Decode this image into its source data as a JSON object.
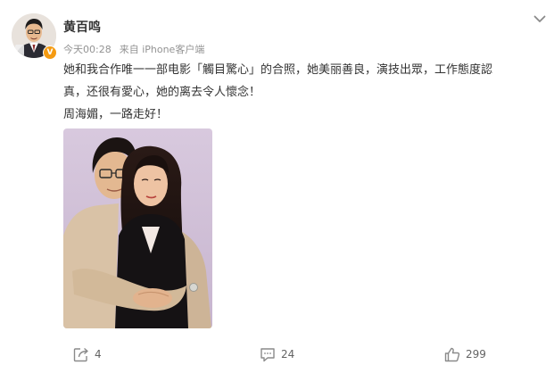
{
  "post": {
    "author": {
      "name": "黄百鸣"
    },
    "meta": {
      "time": "今天00:28",
      "source": "来自 iPhone客户端"
    },
    "text": {
      "line1": "她和我合作唯一一部电影「觸目驚心」的合照，她美丽善良，演技出眾，工作態度認",
      "line2": "真，还很有愛心，她的离去令人懷念！",
      "line3": "周海媚，一路走好！"
    },
    "actions": {
      "repost_count": "4",
      "comment_count": "24",
      "like_count": "299"
    }
  },
  "colors": {
    "text": "#333333",
    "meta": "#939393",
    "icon": "#8a8a8a",
    "verified_badge": "#f59b12"
  },
  "icons": [
    "chevron-down-icon",
    "repost-icon",
    "comment-icon",
    "like-icon",
    "verified-badge-icon"
  ]
}
